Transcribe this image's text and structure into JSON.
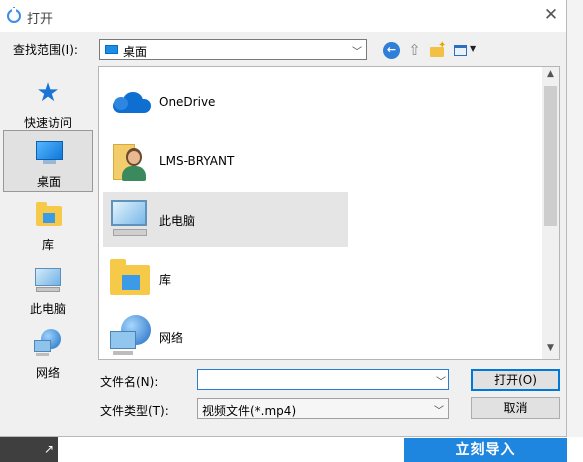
{
  "window": {
    "title": "打开",
    "icon": "app-refresh-icon",
    "close_glyph": "✕"
  },
  "lookin": {
    "label": "查找范围(I):",
    "value": "桌面",
    "icon": "desktop-icon"
  },
  "toolbar": {
    "back_icon": "back-arrow-icon",
    "up_icon": "up-folder-icon",
    "newfolder_icon": "new-folder-icon",
    "views_icon": "view-menu-icon"
  },
  "places": [
    {
      "label": "快速访问",
      "icon": "star-icon",
      "selected": false
    },
    {
      "label": "桌面",
      "icon": "desktop-icon",
      "selected": true
    },
    {
      "label": "库",
      "icon": "library-icon",
      "selected": false
    },
    {
      "label": "此电脑",
      "icon": "computer-icon",
      "selected": false
    },
    {
      "label": "网络",
      "icon": "network-icon",
      "selected": false
    }
  ],
  "files": [
    {
      "name": "OneDrive",
      "icon": "onedrive-cloud-icon",
      "selected": false
    },
    {
      "name": "LMS-BRYANT",
      "icon": "user-folder-icon",
      "selected": false
    },
    {
      "name": "此电脑",
      "icon": "computer-icon",
      "selected": true
    },
    {
      "name": "库",
      "icon": "library-icon",
      "selected": false
    },
    {
      "name": "网络",
      "icon": "network-icon",
      "selected": false
    }
  ],
  "filename": {
    "label": "文件名(N):",
    "value": "",
    "placeholder": ""
  },
  "filetype": {
    "label": "文件类型(T):",
    "value": "视频文件(*.mp4)"
  },
  "buttons": {
    "open": "打开(O)",
    "cancel": "取消"
  },
  "background_app": {
    "import_button": "立刻导入",
    "left_glyph": "↗"
  },
  "colors": {
    "accent": "#0078d7",
    "import_button": "#1f86e0",
    "selection": "#e5e5e5"
  }
}
